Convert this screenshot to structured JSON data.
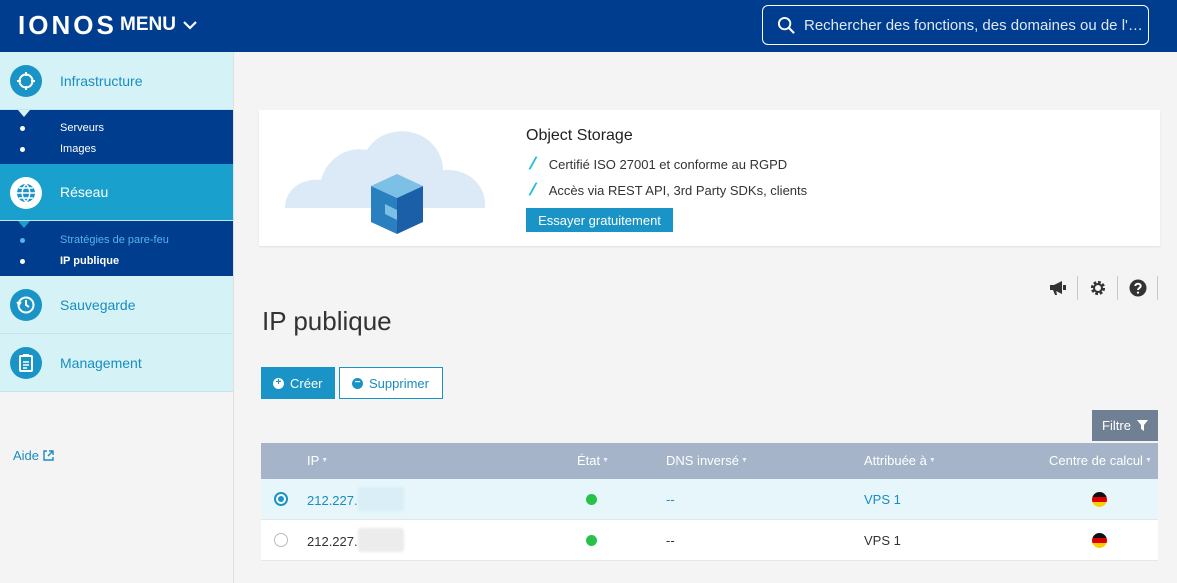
{
  "header": {
    "logo": "IONOS",
    "menu_label": "MENU",
    "search_placeholder": "Rechercher des fonctions, des domaines ou de l'…"
  },
  "sidebar": {
    "sections": [
      {
        "label": "Infrastructure",
        "icon": "infrastructure-icon",
        "sub": [
          "Serveurs",
          "Images"
        ]
      },
      {
        "label": "Réseau",
        "icon": "network-globe-icon",
        "active": true,
        "sub": [
          "Stratégies de pare-feu",
          "IP publique"
        ]
      },
      {
        "label": "Sauvegarde",
        "icon": "backup-clock-icon"
      },
      {
        "label": "Management",
        "icon": "clipboard-icon"
      }
    ],
    "help_link": "Aide"
  },
  "banner": {
    "title": "Object Storage",
    "features": [
      "Certifié ISO 27001 et conforme au RGPD",
      "Accès via REST API, 3rd Party SDKs, clients"
    ],
    "cta": "Essayer gratuitement"
  },
  "page": {
    "title": "IP publique",
    "create_label": "Créer",
    "delete_label": "Supprimer",
    "filter_label": "Filtre"
  },
  "table": {
    "columns": [
      "IP",
      "État",
      "DNS inversé",
      "Attribuée à",
      "Centre de calcul"
    ],
    "rows": [
      {
        "ip": "212.227.",
        "dns": "--",
        "assigned": "VPS 1",
        "selected": true
      },
      {
        "ip": "212.227.",
        "dns": "--",
        "assigned": "VPS 1",
        "selected": false
      }
    ]
  },
  "colors": {
    "header_bg": "#003d8f",
    "accent": "#1a94c6",
    "status_ok": "#28c14a"
  }
}
